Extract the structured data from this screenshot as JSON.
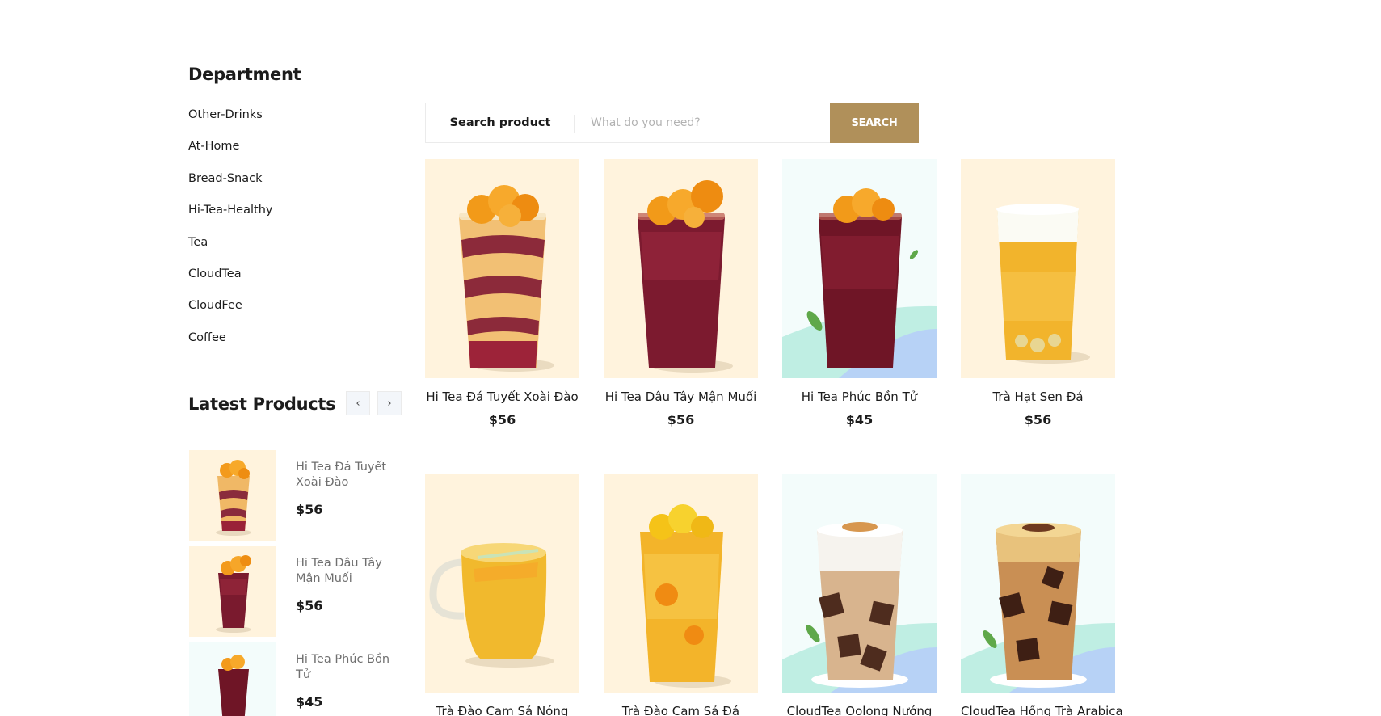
{
  "sidebar": {
    "department_title": "Department",
    "departments": [
      "Other-Drinks",
      "At-Home",
      "Bread-Snack",
      "Hi-Tea-Healthy",
      "Tea",
      "CloudTea",
      "CloudFee",
      "Coffee"
    ],
    "latest_title": "Latest Products",
    "prev_arrow": "‹",
    "next_arrow": "›",
    "latest_products": [
      {
        "name": "Hi Tea Đá Tuyết Xoài Đào",
        "price": "$56"
      },
      {
        "name": "Hi Tea Dâu Tây Mận Muối",
        "price": "$56"
      },
      {
        "name": "Hi Tea Phúc Bồn Tử",
        "price": "$45"
      }
    ]
  },
  "search": {
    "category_label": "Search product",
    "placeholder": "What do you need?",
    "button_label": "SEARCH"
  },
  "products": [
    {
      "name": "Hi Tea Đá Tuyết Xoài Đào",
      "price": "$56"
    },
    {
      "name": "Hi Tea Dâu Tây Mận Muối",
      "price": "$56"
    },
    {
      "name": "Hi Tea Phúc Bồn Tử",
      "price": "$45"
    },
    {
      "name": "Trà Hạt Sen Đá",
      "price": "$56"
    },
    {
      "name": "Trà Đào Cam Sả Nóng",
      "price": ""
    },
    {
      "name": "Trà Đào Cam Sả Đá",
      "price": ""
    },
    {
      "name": "CloudTea Oolong Nướng",
      "price": ""
    },
    {
      "name": "CloudTea Hồng Trà Arabica",
      "price": ""
    }
  ],
  "colors": {
    "accent": "#b0905a",
    "cream_bg": "#fff3dd",
    "mint_bg": "#f3fcfb"
  }
}
